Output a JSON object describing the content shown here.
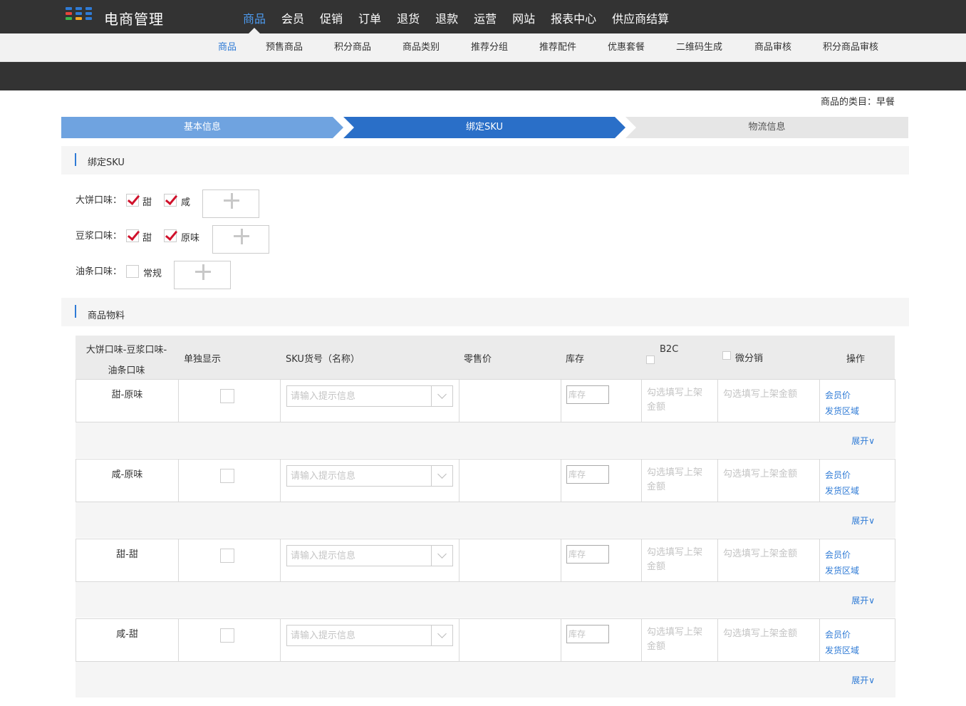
{
  "brand": {
    "name": "电商管理"
  },
  "main_nav": [
    {
      "label": "商品",
      "active": true
    },
    {
      "label": "会员"
    },
    {
      "label": "促销"
    },
    {
      "label": "订单"
    },
    {
      "label": "退货"
    },
    {
      "label": "退款"
    },
    {
      "label": "运营"
    },
    {
      "label": "网站"
    },
    {
      "label": "报表中心"
    },
    {
      "label": "供应商结算"
    }
  ],
  "sub_nav": [
    {
      "label": "商品",
      "active": true
    },
    {
      "label": "预售商品"
    },
    {
      "label": "积分商品"
    },
    {
      "label": "商品类别"
    },
    {
      "label": "推荐分组"
    },
    {
      "label": "推荐配件"
    },
    {
      "label": "优惠套餐"
    },
    {
      "label": "二维码生成"
    },
    {
      "label": "商品审核"
    },
    {
      "label": "积分商品审核"
    }
  ],
  "category_text": "商品的类目：早餐",
  "steps": [
    {
      "label": "基本信息",
      "state": "done"
    },
    {
      "label": "绑定SKU",
      "state": "current"
    },
    {
      "label": "物流信息",
      "state": "pending"
    }
  ],
  "sections": {
    "bind_sku": "绑定SKU",
    "materials": "商品物料"
  },
  "attributes": [
    {
      "label": "大饼口味：",
      "options": [
        {
          "label": "甜",
          "checked": true
        },
        {
          "label": "咸",
          "checked": true
        }
      ]
    },
    {
      "label": "豆浆口味：",
      "options": [
        {
          "label": "甜",
          "checked": true
        },
        {
          "label": "原味",
          "checked": true
        }
      ]
    },
    {
      "label": "油条口味：",
      "options": [
        {
          "label": "常规",
          "checked": false
        }
      ]
    }
  ],
  "table": {
    "headers": {
      "combo_line1": "大饼口味-豆浆口味-",
      "combo_line2": "油条口味",
      "single_display": "单独显示",
      "sku": "SKU货号（名称）",
      "retail_price": "零售价",
      "stock": "库存",
      "b2c": "B2C",
      "micro": "微分销",
      "actions": "操作"
    },
    "sku_placeholder": "请输入提示信息",
    "stock_placeholder": "库存",
    "hint_b2c": "勾选填写上架金额",
    "hint_micro": "勾选填写上架金额",
    "member_price": "会员价",
    "ship_area": "发货区域",
    "expand_label": "展开∨",
    "rows": [
      {
        "name": "甜-原味"
      },
      {
        "name": "咸-原味"
      },
      {
        "name": "甜-甜"
      },
      {
        "name": "咸-甜"
      }
    ]
  },
  "colors": {
    "topbar": "#333333",
    "accent": "#2f7bd6",
    "step_done": "#6fa3e0",
    "step_current": "#2a6fc8",
    "step_pending": "#e6e6e6",
    "check": "#d0112b"
  }
}
